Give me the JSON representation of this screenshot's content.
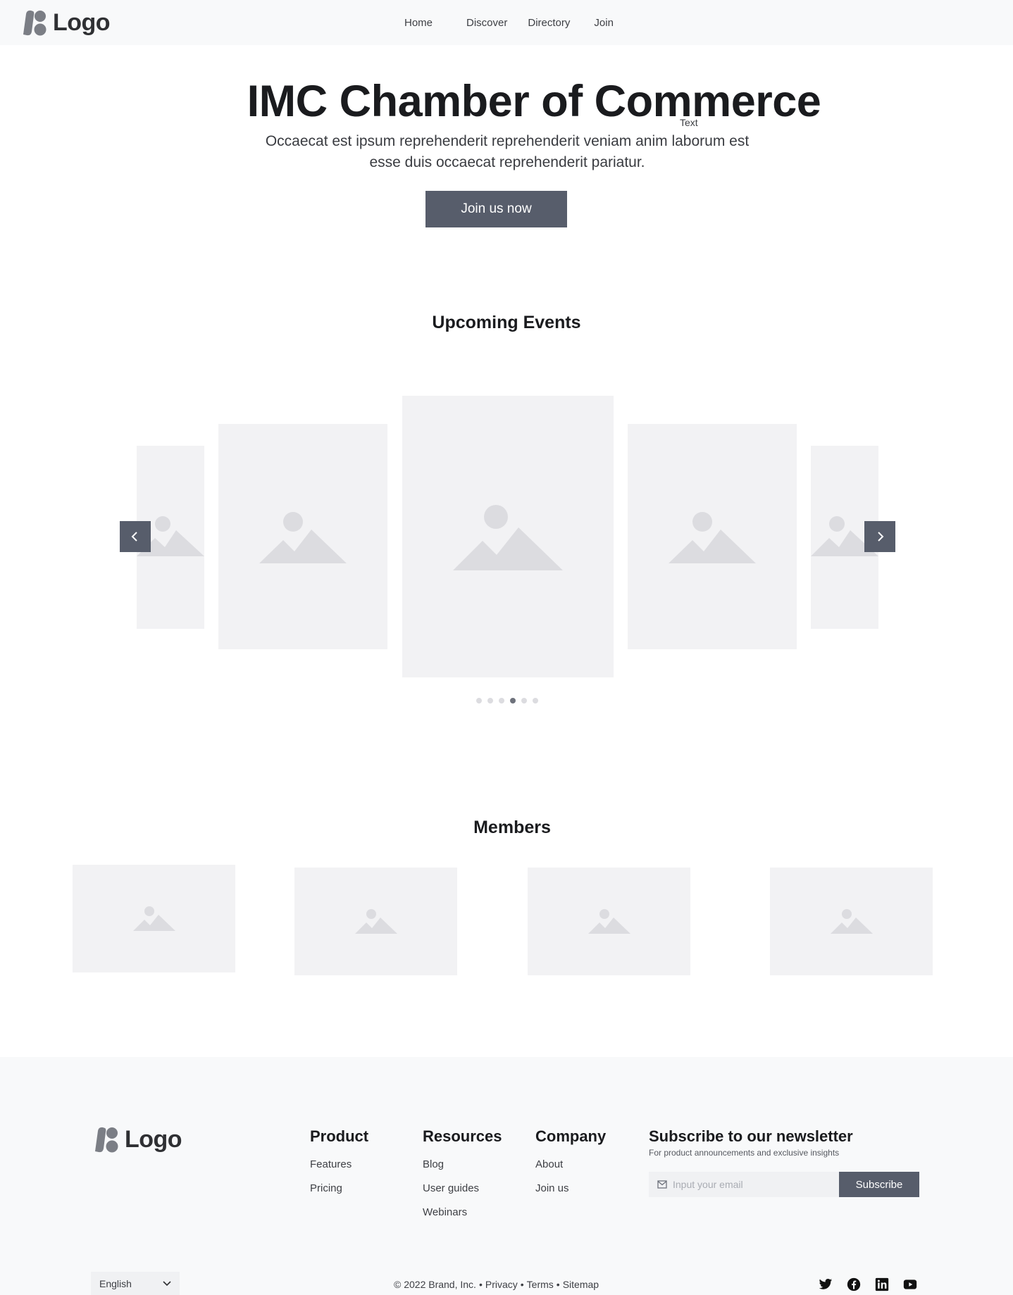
{
  "header": {
    "logo_text": "Logo",
    "nav": [
      "Home",
      "Discover",
      "Directory",
      "Join"
    ]
  },
  "hero": {
    "title": "IMC Chamber of Commerce",
    "text_tag": "Text",
    "subtitle": "Occaecat est ipsum reprehenderit reprehenderit veniam anim laborum est esse duis occaecat reprehenderit pariatur.",
    "cta_label": "Join us now"
  },
  "events": {
    "title": "Upcoming Events",
    "prev_icon": "chevron-left-icon",
    "next_icon": "chevron-right-icon",
    "slide_count": 5,
    "dot_count": 6,
    "active_dot": 3
  },
  "members": {
    "title": "Members",
    "count": 4
  },
  "footer": {
    "logo_text": "Logo",
    "product": {
      "title": "Product",
      "links": [
        "Features",
        "Pricing"
      ]
    },
    "resources": {
      "title": "Resources",
      "links": [
        "Blog",
        "User guides",
        "Webinars"
      ]
    },
    "company": {
      "title": "Company",
      "links": [
        "About",
        "Join us"
      ]
    },
    "newsletter": {
      "title": "Subscribe to our newsletter",
      "subtitle": "For product announcements and exclusive insights",
      "placeholder": "Input your email",
      "button_label": "Subscribe"
    },
    "language": "English",
    "legal": {
      "copyright": "© 2022 Brand, Inc.",
      "separator": "•",
      "privacy": "Privacy",
      "terms": "Terms",
      "sitemap": "Sitemap"
    },
    "socials": [
      "twitter-icon",
      "facebook-icon",
      "linkedin-icon",
      "youtube-icon"
    ]
  },
  "colors": {
    "accent": "#575d6b",
    "placeholder_bg": "#f2f2f4",
    "placeholder_icon": "#dcdce0",
    "surface": "#f8f9fa"
  }
}
